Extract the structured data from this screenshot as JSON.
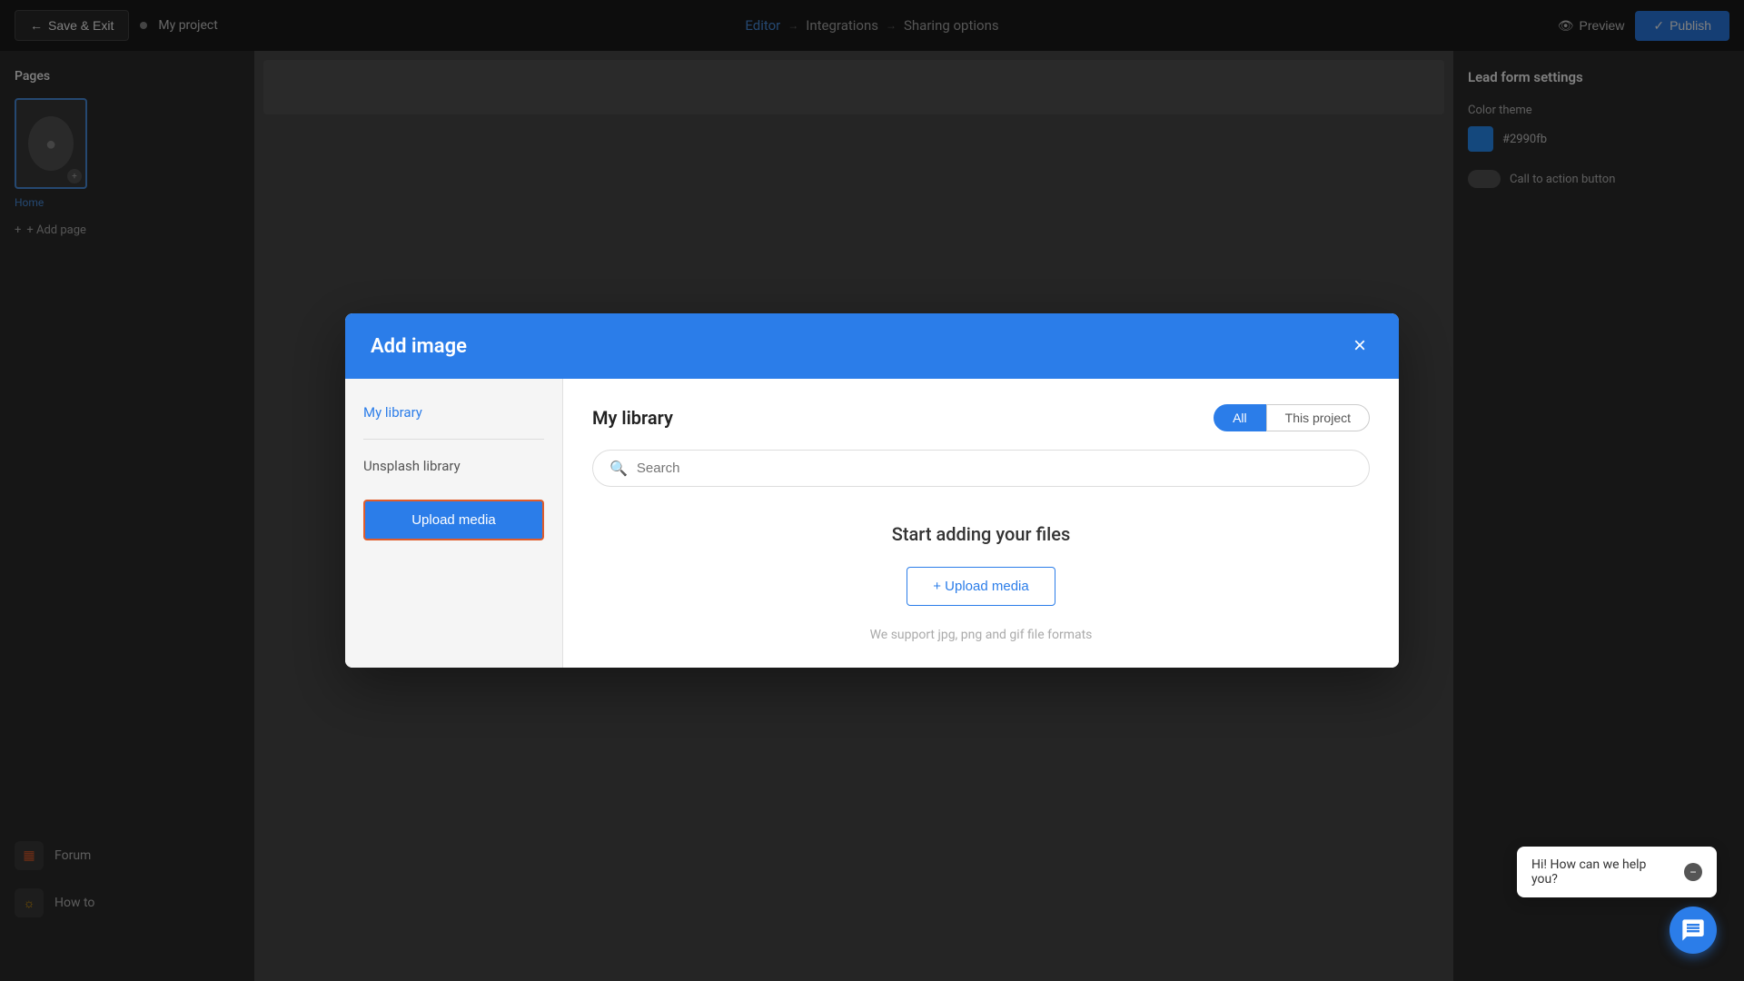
{
  "topnav": {
    "save_exit_label": "Save & Exit",
    "project_name": "My project",
    "editor_label": "Editor",
    "integrations_label": "Integrations",
    "sharing_options_label": "Sharing options",
    "preview_label": "Preview",
    "publish_label": "Publish"
  },
  "left_sidebar": {
    "pages_title": "Pages",
    "home_page_label": "Home",
    "add_page_label": "+ Add page"
  },
  "right_sidebar": {
    "settings_title": "Lead form settings",
    "color_theme_label": "Color theme",
    "color_hex": "#2990fb",
    "cta_button_label": "Call to action button"
  },
  "modal": {
    "title": "Add image",
    "close_label": "×",
    "sidebar": {
      "my_library_label": "My library",
      "unsplash_library_label": "Unsplash library",
      "upload_media_btn": "Upload media"
    },
    "content": {
      "library_title": "My library",
      "filter_all": "All",
      "filter_this_project": "This project",
      "search_placeholder": "Search",
      "empty_title": "Start adding your files",
      "upload_media_btn": "+ Upload media",
      "support_text": "We support jpg, png and gif file formats"
    }
  },
  "bottom_sidebar": {
    "forum_label": "Forum",
    "how_to_label": "How to"
  },
  "chat": {
    "message": "Hi! How can we help you?",
    "dismiss_label": "−"
  }
}
